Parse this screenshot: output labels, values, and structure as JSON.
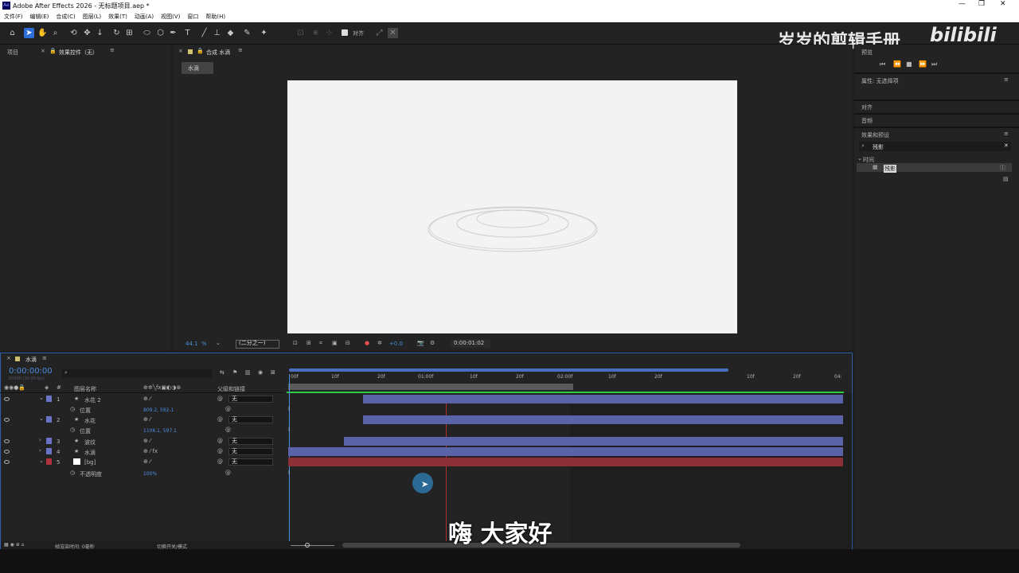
{
  "window": {
    "title": "Adobe After Effects 2026 - 无标题项目.aep *",
    "app_icon": "Ae"
  },
  "menu": [
    "文件(F)",
    "编辑(E)",
    "合成(C)",
    "图层(L)",
    "效果(T)",
    "动画(A)",
    "视图(V)",
    "窗口",
    "帮助(H)"
  ],
  "toolbar": {
    "align_label": "对齐"
  },
  "watermark": {
    "text": "岁岁的剪辑手册",
    "logo": "bilibili"
  },
  "left_panel": {
    "project_tab": "项目",
    "effects_tab": "效果控件（无）"
  },
  "comp_panel": {
    "tab": "合成 水滴",
    "breadcrumb": "水滴",
    "zoom": "44.1",
    "zoom_unit": "%",
    "resolution": "(二分之一)",
    "exposure": "+0.0",
    "timecode": "0:00:01:02"
  },
  "right_panel": {
    "preview_title": "预览",
    "properties": "属性: 无选择项",
    "align": "对齐",
    "audio": "音频",
    "effects_presets": "效果和预设",
    "search_value": "残影",
    "category": "时间",
    "result": "残影"
  },
  "timeline": {
    "tab": "水滴",
    "timecode": "0:00:00:00",
    "timecode_sub": "00000 (30.00 fps)",
    "headers": {
      "layer_name": "图层名称",
      "parent": "父级和链接"
    },
    "ruler": [
      "00f",
      "10f",
      "20f",
      "01:00f",
      "10f",
      "20f",
      "02:00f",
      "10f",
      "20f",
      "10f",
      "20f",
      "04:"
    ],
    "layers": [
      {
        "num": "1",
        "name": "水花 2",
        "parent": "无",
        "color": "#6b73c9"
      },
      {
        "num": "",
        "name": "位置",
        "value": "809.2, 592.1"
      },
      {
        "num": "2",
        "name": "水花",
        "parent": "无",
        "color": "#6b73c9"
      },
      {
        "num": "",
        "name": "位置",
        "value": "1106.1, 597.1"
      },
      {
        "num": "3",
        "name": "波纹",
        "parent": "无",
        "color": "#6b73c9"
      },
      {
        "num": "4",
        "name": "水滴",
        "parent": "无",
        "color": "#6b73c9"
      },
      {
        "num": "5",
        "name": "[bg]",
        "parent": "无",
        "color": "#b0343e"
      },
      {
        "num": "",
        "name": "不透明度",
        "value": "100%"
      }
    ],
    "footer_render": "帧渲染时间: 0毫秒",
    "footer_mode": "切换开关/模式"
  },
  "subtitle": "嗨 大家好"
}
